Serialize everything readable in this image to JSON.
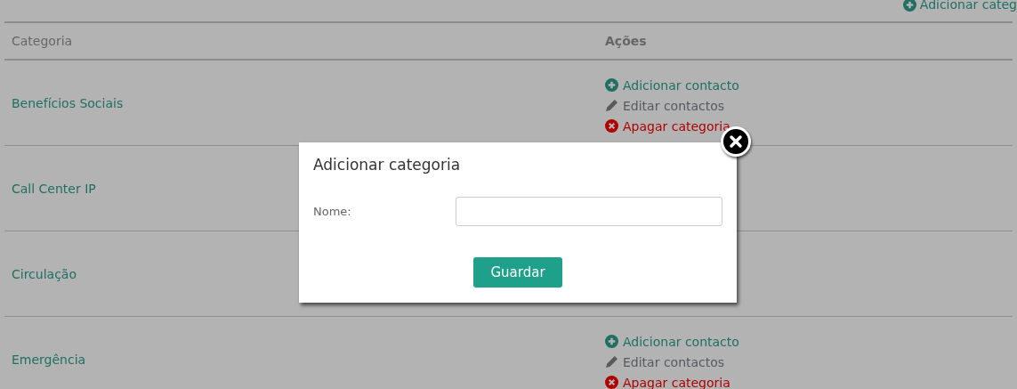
{
  "top_link": {
    "label": "Adicionar categ"
  },
  "table": {
    "columns": [
      "Categoria",
      "Ações"
    ],
    "rows": [
      {
        "name": "Benefícios Sociais",
        "actions": [
          {
            "kind": "add",
            "label": "Adicionar contacto"
          },
          {
            "kind": "edit",
            "label": "Editar contactos"
          },
          {
            "kind": "delete",
            "label": "Apagar categoria"
          }
        ]
      },
      {
        "name": "Call Center IP"
      },
      {
        "name": "Circulação"
      },
      {
        "name": "Emergência",
        "actions": [
          {
            "kind": "add",
            "label": "Adicionar contacto"
          },
          {
            "kind": "edit",
            "label": "Editar contactos"
          },
          {
            "kind": "delete",
            "label": "Apagar categoria"
          }
        ]
      }
    ]
  },
  "modal": {
    "title": "Adicionar categoria",
    "field_label": "Nome:",
    "button": "Guardar"
  }
}
